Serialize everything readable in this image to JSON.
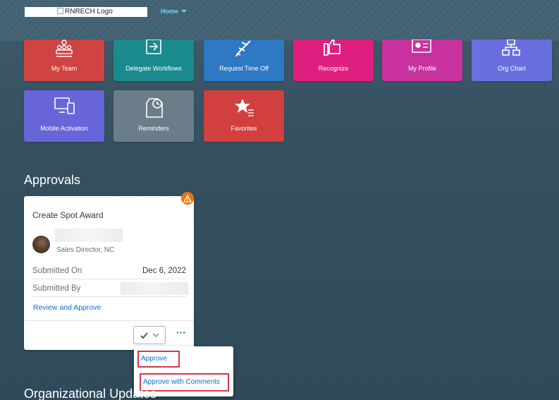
{
  "header": {
    "logo_alt": "RNRECH Logo",
    "home_label": "Home"
  },
  "tiles": [
    {
      "label": "My Team",
      "icon": "team-icon",
      "color": "#d04343"
    },
    {
      "label": "Delegate Workflows",
      "icon": "delegate-arrow-icon",
      "color": "#1a8a8e"
    },
    {
      "label": "Request Time Off",
      "icon": "airplane-icon",
      "color": "#2f78c4"
    },
    {
      "label": "Recognize",
      "icon": "thumbs-up-icon",
      "color": "#df1f80"
    },
    {
      "label": "My Profile",
      "icon": "id-card-icon",
      "color": "#c8329e"
    },
    {
      "label": "Org Chart",
      "icon": "org-chart-icon",
      "color": "#6a6fe0"
    },
    {
      "label": "Mobile Activation",
      "icon": "mobile-devices-icon",
      "color": "#6865d9"
    },
    {
      "label": "Reminders",
      "icon": "clock-document-icon",
      "color": "#6b7d89"
    },
    {
      "label": "Favorites",
      "icon": "star-list-icon",
      "color": "#d13f3f"
    }
  ],
  "approvals": {
    "section_title": "Approvals",
    "card": {
      "title": "Create Spot Award",
      "requester_role": "Sales Director, NC",
      "submitted_on_label": "Submitted On",
      "submitted_on_value": "Dec 6, 2022",
      "submitted_by_label": "Submitted By",
      "review_link": "Review and Approve"
    },
    "menu": {
      "approve": "Approve",
      "approve_with_comments": "Approve with Comments"
    }
  },
  "next_section_title": "Organizational Updates"
}
